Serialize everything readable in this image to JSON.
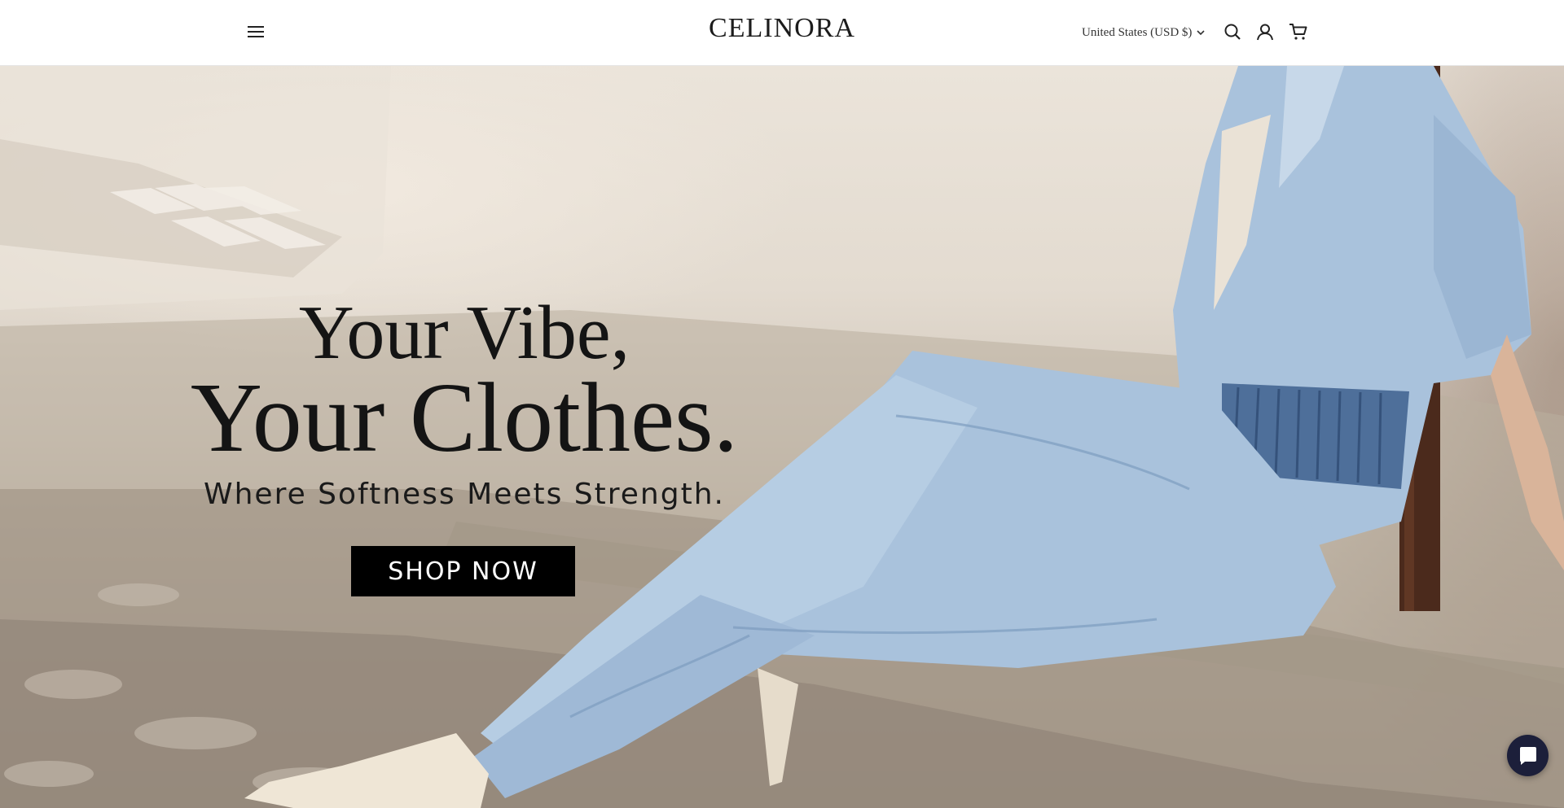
{
  "header": {
    "logo": "CELINORA",
    "country_selector": "United States (USD $)",
    "icons": [
      "menu-icon",
      "search-icon",
      "account-icon",
      "cart-icon"
    ]
  },
  "hero": {
    "line1": "Your Vibe,",
    "line2": "Your Clothes.",
    "tagline": "Where Softness Meets Strength.",
    "cta_label": "SHOP NOW"
  },
  "chat": {
    "icon": "chat-icon"
  },
  "colors": {
    "header_bg": "#ffffff",
    "cta_bg": "#000000",
    "cta_text": "#ffffff",
    "chat_bg": "#1c1f3a",
    "denim": "#a9c2dc"
  }
}
